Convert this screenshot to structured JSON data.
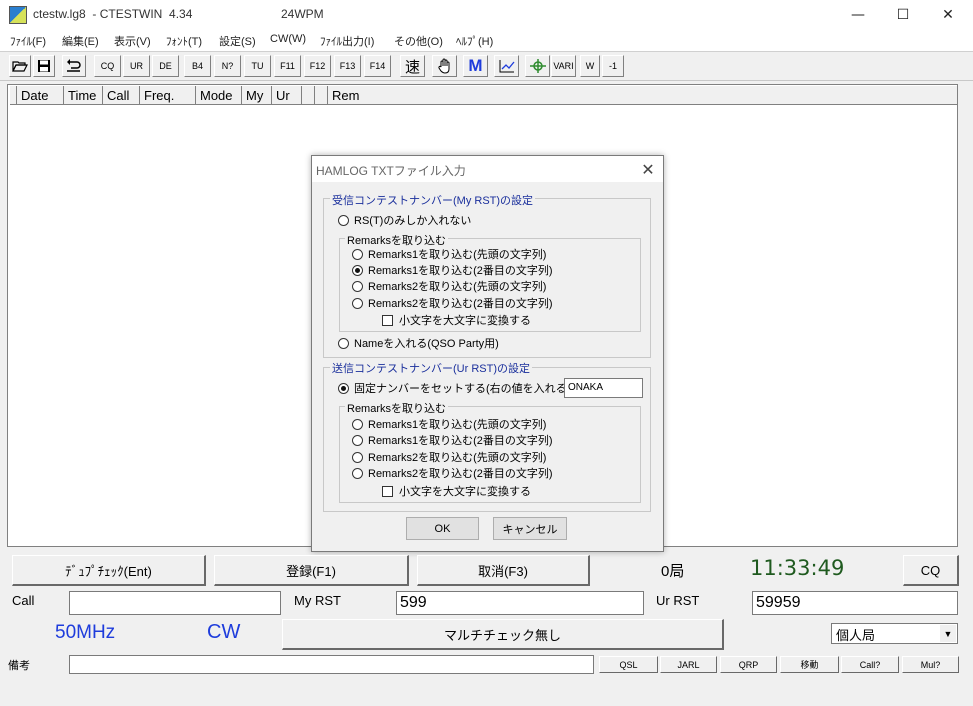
{
  "window": {
    "title": "ctestw.lg8  - CTESTWIN  4.34",
    "wpm": "24WPM",
    "minimize": "—",
    "maximize": "☐",
    "close": "✕"
  },
  "menu": [
    "ﾌｧｲﾙ(F)",
    "編集(E)",
    "表示(V)",
    "ﾌｫﾝﾄ(T)",
    "設定(S)",
    "CW(W)",
    "ﾌｧｲﾙ出力(I)",
    "その他(O)",
    "ﾍﾙﾌﾟ(H)"
  ],
  "toolbar": {
    "open_icon": "folder-open-icon",
    "save_icon": "floppy-icon",
    "undo_icon": "undo-icon",
    "buttons": [
      "CQ",
      "UR",
      "DE",
      "B4",
      "N?",
      "TU",
      "F11",
      "F12",
      "F13",
      "F14"
    ],
    "speed": "速",
    "hand_icon": "hand-icon",
    "m": "M",
    "graph_icon": "graph-icon",
    "satellite_icon": "satellite-icon",
    "vari": "VARI",
    "w": "W",
    "minus1": "-1"
  },
  "log_columns": [
    "Date",
    "Time",
    "Call",
    "Freq.",
    "Mode",
    "My",
    "Ur",
    "",
    "",
    "Rem"
  ],
  "dialog": {
    "title": "HAMLOG TXTファイル入力",
    "close": "✕",
    "my_group": {
      "label": "受信コンテストナンバー(My RST)の設定",
      "rst_only": "RS(T)のみしか入れない",
      "remarks_label": "Remarksを取り込む",
      "options": [
        "Remarks1を取り込む(先頭の文字列)",
        "Remarks1を取り込む(2番目の文字列)",
        "Remarks2を取り込む(先頭の文字列)",
        "Remarks2を取り込む(2番目の文字列)"
      ],
      "uppercase": "小文字を大文字に変換する",
      "name_option": "Nameを入れる(QSO Party用)"
    },
    "ur_group": {
      "label": "送信コンテストナンバー(Ur RST)の設定",
      "fixed_option": "固定ナンバーをセットする(右の値を入れる)",
      "fixed_value": "ONAKA",
      "remarks_label": "Remarksを取り込む",
      "options": [
        "Remarks1を取り込む(先頭の文字列)",
        "Remarks1を取り込む(2番目の文字列)",
        "Remarks2を取り込む(先頭の文字列)",
        "Remarks2を取り込む(2番目の文字列)"
      ],
      "uppercase": "小文字を大文字に変換する"
    },
    "ok": "OK",
    "cancel": "キャンセル"
  },
  "bottom": {
    "dupe_check": "ﾃﾞｭﾌﾟﾁｪｯｸ(Ent)",
    "register": "登録(F1)",
    "cancel": "取消(F3)",
    "count": "0局",
    "clock": "11:33:49",
    "cq": "CQ",
    "call_label": "Call",
    "call_value": "",
    "my_rst_label": "My RST",
    "my_rst_value": "599",
    "ur_rst_label": "Ur RST",
    "ur_rst_value": "59959",
    "band": "50MHz",
    "mode": "CW",
    "multi_check": "マルチチェック無し",
    "station_type": "個人局",
    "remarks_label": "備考",
    "remarks_value": "",
    "small_buttons": [
      "QSL",
      "JARL",
      "QRP",
      "移動",
      "Call?",
      "Mul?"
    ]
  },
  "colors": {
    "blue_text": "#1e3cdc",
    "clock_green": "#1f5a1f",
    "dialog_group_label": "#1a2f9c"
  }
}
